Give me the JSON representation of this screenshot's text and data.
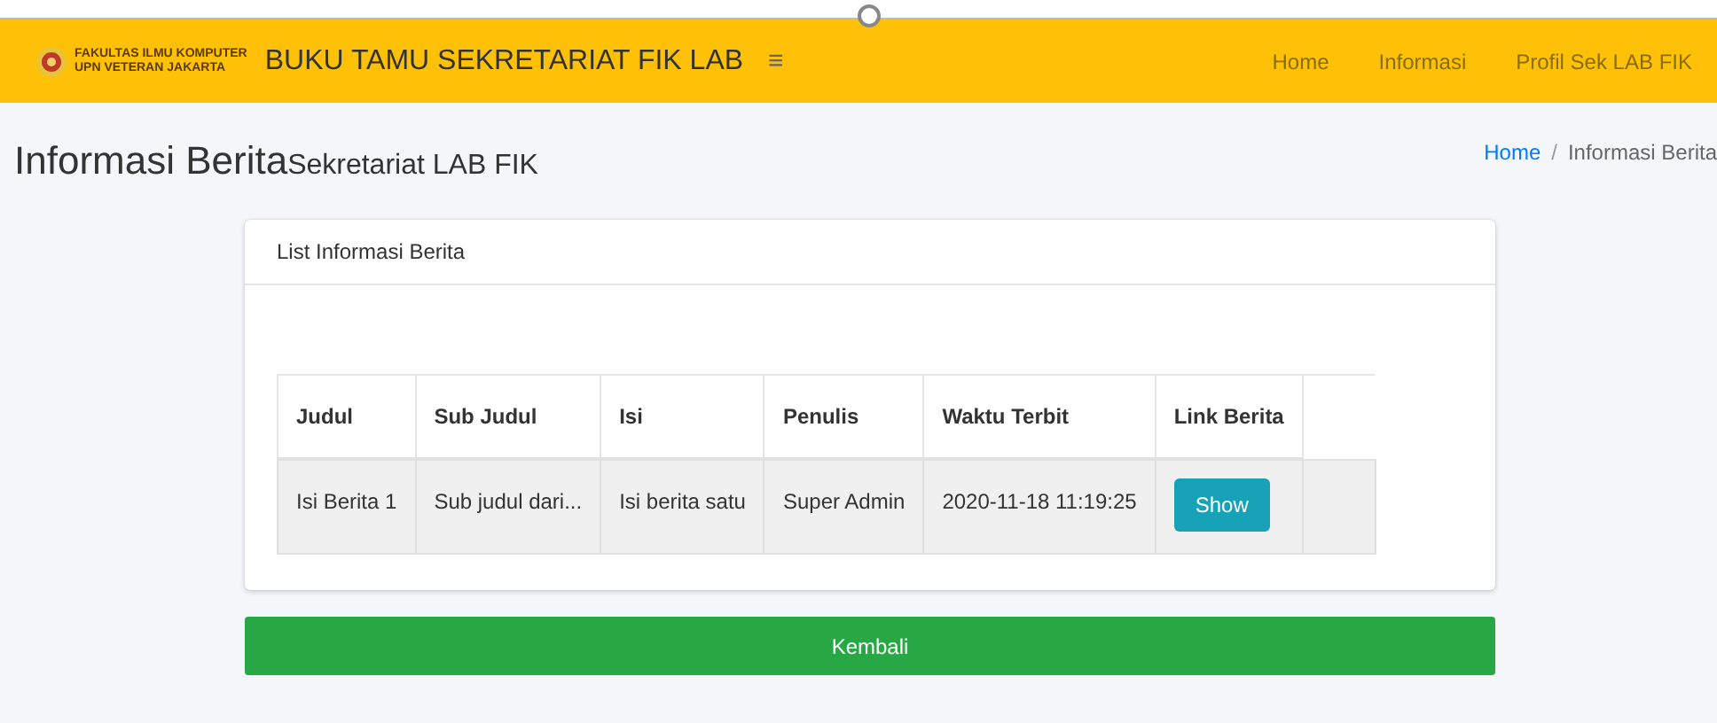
{
  "navbar": {
    "logo_lines": [
      "FAKULTAS ILMU KOMPUTER",
      "UPN VETERAN JAKARTA"
    ],
    "brand": "BUKU TAMU SEKRETARIAT FIK LAB",
    "menu_toggle": "≡",
    "links": [
      "Home",
      "Informasi",
      "Profil Sek LAB FIK"
    ]
  },
  "page": {
    "title": "Informasi Berita",
    "subtitle": "Sekretariat LAB FIK",
    "breadcrumb": [
      {
        "label": "Home",
        "kind": "link"
      },
      {
        "label": "/",
        "kind": "separator"
      },
      {
        "label": "Informasi Berita",
        "kind": "current"
      }
    ]
  },
  "card": {
    "title": "List Informasi Berita",
    "table": {
      "columns": [
        "Judul",
        "Sub Judul",
        "Isi",
        "Penulis",
        "Waktu Terbit",
        "Link Berita"
      ],
      "rows": [
        {
          "cells": [
            "Isi Berita 1",
            "Sub judul dari...",
            "Isi berita satu",
            "Super Admin",
            "2020-11-18 11:19:25"
          ],
          "button": "Show"
        }
      ]
    }
  },
  "back_button": "Kembali"
}
